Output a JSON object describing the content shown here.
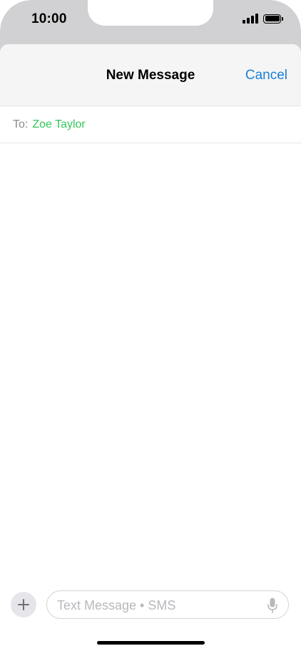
{
  "status_bar": {
    "time": "10:00",
    "icons": [
      "signal-icon",
      "battery-icon"
    ]
  },
  "nav": {
    "title": "New Message",
    "cancel_label": "Cancel"
  },
  "recipient": {
    "label": "To:",
    "name": "Zoe Taylor"
  },
  "composer": {
    "placeholder": "Text Message • SMS",
    "value": "",
    "add_icon": "plus-icon",
    "mic_icon": "microphone-icon"
  },
  "colors": {
    "accent": "#1a7fd6",
    "recipient": "#34c759",
    "nav_background": "#f5f5f5",
    "outer_background": "#d1d1d3"
  }
}
